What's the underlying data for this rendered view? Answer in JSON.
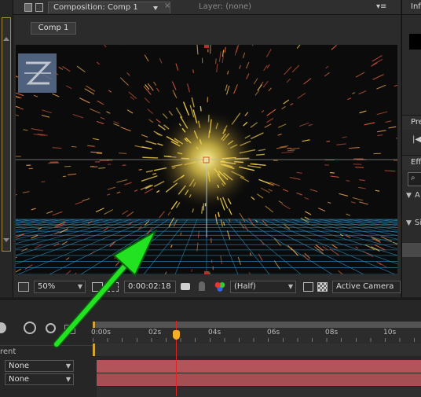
{
  "comp_panel": {
    "tab_title": "Composition: Comp 1",
    "layer_tab": "Layer: (none)",
    "comp_button": "Comp 1"
  },
  "viewer_toolbar": {
    "zoom": "50%",
    "timecode": "0:00:02:18",
    "resolution": "(Half)",
    "camera": "Active Camera"
  },
  "right_panels": {
    "info_tab": "Inf",
    "preview_tab": "Pre",
    "effects_tab": "Eff",
    "item_a": "A",
    "item_s": "Si"
  },
  "timeline": {
    "parent_label": "rent",
    "ruler": [
      "0:00s",
      "02s",
      "04s",
      "06s",
      "08s",
      "10s"
    ],
    "current_time_label": "02s",
    "layers": [
      {
        "parent": "None"
      },
      {
        "parent": "None"
      }
    ]
  },
  "colors": {
    "annotation_arrow": "#22e222",
    "playhead": "#f3b026",
    "layer_bar": "#b3545a"
  }
}
